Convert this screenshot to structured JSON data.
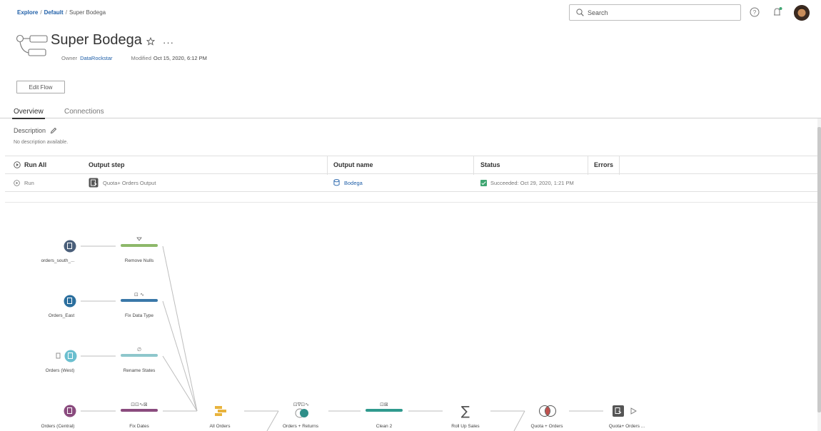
{
  "breadcrumb": {
    "explore": "Explore",
    "default": "Default",
    "current": "Super Bodega"
  },
  "search": {
    "placeholder": "Search"
  },
  "header": {
    "title": "Super Bodega",
    "owner_label": "Owner",
    "owner_value": "DataRockstar",
    "modified_label": "Modified",
    "modified_value": "Oct 15, 2020, 6:12 PM",
    "edit_button": "Edit Flow"
  },
  "tabs": [
    {
      "label": "Overview"
    },
    {
      "label": "Connections"
    }
  ],
  "description": {
    "label": "Description",
    "value": "No description available."
  },
  "table": {
    "headers": {
      "run_all": "Run All",
      "output_step": "Output step",
      "output_name": "Output name",
      "status": "Status",
      "errors": "Errors"
    },
    "row": {
      "run": "Run",
      "output_step": "Quota+ Orders Output",
      "output_name": "Bodega",
      "status": "Succeeded: Oct 29, 2020, 1:21 PM",
      "errors": ""
    }
  },
  "flow": {
    "inputs": [
      {
        "label": "orders_south_...",
        "color": "#4a5f7a"
      },
      {
        "label": "Orders_East",
        "color": "#2b6f9e"
      },
      {
        "label": "Orders (West)",
        "color": "#6bbfcf"
      },
      {
        "label": "Orders (Central)",
        "color": "#8a4b7e"
      }
    ],
    "cleans": [
      {
        "label": "Remove Nulls",
        "color": "#8db86a"
      },
      {
        "label": "Fix Data Type",
        "color": "#3a78a8"
      },
      {
        "label": "Rename States",
        "color": "#8ec7cc"
      },
      {
        "label": "Fix Dates",
        "color": "#8a4b7e"
      }
    ],
    "bottom": [
      {
        "label": "All Orders",
        "color": "#e8b33c"
      },
      {
        "label": "Orders + Returns",
        "color": "#2f8f89"
      },
      {
        "label": "Clean 2",
        "color": "#2f9a8e"
      },
      {
        "label": "Roll Up Sales",
        "color": "#555555"
      },
      {
        "label": "Quota + Orders",
        "color": "#c0504d"
      },
      {
        "label": "Quota+ Orders ...",
        "color": "#555555"
      }
    ]
  }
}
